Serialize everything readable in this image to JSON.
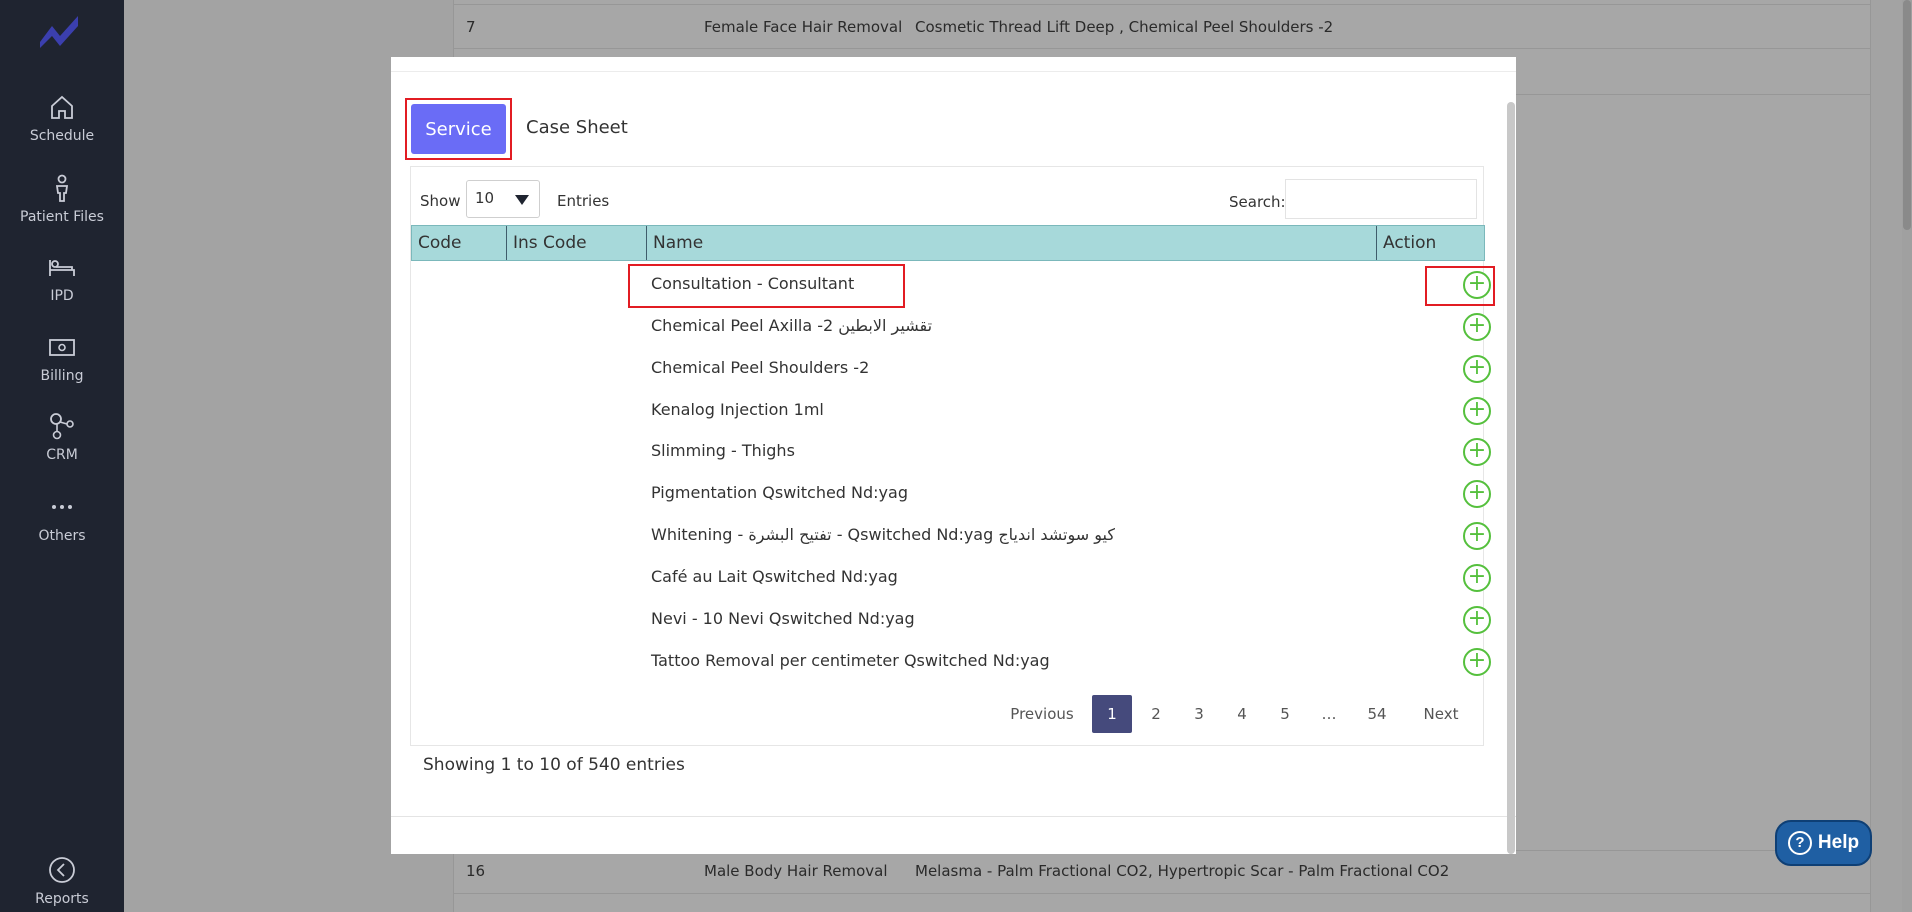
{
  "sidebar": {
    "items": [
      {
        "label": "Schedule",
        "icon": "home-icon"
      },
      {
        "label": "Patient Files",
        "icon": "person-icon"
      },
      {
        "label": "IPD",
        "icon": "bed-icon"
      },
      {
        "label": "Billing",
        "icon": "money-icon"
      },
      {
        "label": "CRM",
        "icon": "crm-icon"
      },
      {
        "label": "Others",
        "icon": "more-icon"
      },
      {
        "label": "Reports",
        "icon": "back-circle-icon"
      }
    ]
  },
  "background_rows": [
    {
      "id": "7",
      "category": "Female Face Hair Removal",
      "services": "Cosmetic Thread Lift Deep , Chemical Peel Shoulders -2"
    },
    {
      "id": "16",
      "category": "Male Body Hair Removal",
      "services": "Melasma - Palm Fractional CO2, Hypertropic Scar - Palm Fractional CO2"
    }
  ],
  "modal": {
    "tabs": {
      "service": "Service",
      "case_sheet": "Case Sheet"
    },
    "show_label": "Show",
    "entries_value": "10",
    "entries_label": "Entries",
    "search_label": "Search:",
    "search_value": "",
    "columns": [
      "Code",
      "Ins Code",
      "Name",
      "Action"
    ],
    "rows": [
      {
        "code": "",
        "ins_code": "",
        "name": "Consultation - Consultant"
      },
      {
        "code": "",
        "ins_code": "",
        "name": "Chemical Peel Axilla -2 تقشير الابطين"
      },
      {
        "code": "",
        "ins_code": "",
        "name": "Chemical Peel Shoulders -2"
      },
      {
        "code": "",
        "ins_code": "",
        "name": "Kenalog Injection 1ml"
      },
      {
        "code": "",
        "ins_code": "",
        "name": "Slimming - Thighs"
      },
      {
        "code": "",
        "ins_code": "",
        "name": "Pigmentation Qswitched Nd:yag"
      },
      {
        "code": "",
        "ins_code": "",
        "name": "Whitening - تفتيح البشرة - Qswitched Nd:yag كيو سوتشد اندياج"
      },
      {
        "code": "",
        "ins_code": "",
        "name": "Café au Lait Qswitched Nd:yag"
      },
      {
        "code": "",
        "ins_code": "",
        "name": "Nevi - 10 Nevi Qswitched Nd:yag"
      },
      {
        "code": "",
        "ins_code": "",
        "name": "Tattoo Removal per centimeter Qswitched Nd:yag"
      }
    ],
    "showing_text": "Showing 1 to 10 of 540 entries",
    "pagination": {
      "previous": "Previous",
      "pages": [
        "1",
        "2",
        "3",
        "4",
        "5",
        "…",
        "54"
      ],
      "active": "1",
      "next": "Next"
    }
  },
  "help": {
    "label": "Help",
    "glyph": "?"
  },
  "colors": {
    "sidebar_bg": "#1f2430",
    "primary": "#6a6cf6",
    "table_header": "#a7d9da",
    "add_icon": "#55c03d",
    "active_page": "#454a7c",
    "highlight": "#e21c23",
    "help_bg": "#1f5fa3"
  }
}
